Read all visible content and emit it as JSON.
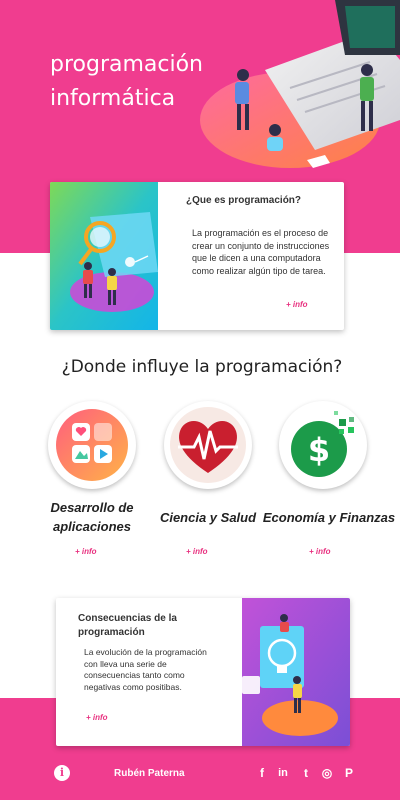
{
  "hero": {
    "title_line1": "programación",
    "title_line2": "informática"
  },
  "intro_card": {
    "title": "¿Que es programación?",
    "text": "La programación es el proceso de crear un conjunto de instrucciones que le dicen a una computadora como realizar algún tipo de tarea.",
    "more_label": "+ info"
  },
  "influence": {
    "title": "¿Donde influye la programación?",
    "areas": [
      {
        "label_line1": "Desarrollo de",
        "label_line2": "aplicaciones",
        "more_label": "+ info",
        "icon": "apps-icon"
      },
      {
        "label_line1": "Ciencia y Salud",
        "label_line2": "",
        "more_label": "+ info",
        "icon": "heart-pulse-icon"
      },
      {
        "label_line1": "Economía y Finanzas",
        "label_line2": "",
        "more_label": "+ info",
        "icon": "dollar-icon"
      }
    ]
  },
  "consequences_card": {
    "title": "Consecuencias de la programación",
    "text": "La evolución de la programación con lleva una serie de consecuencias tanto como negativas como positibas.",
    "more_label": "+ info"
  },
  "footer": {
    "info_icon": "info-icon",
    "info_glyph": "i",
    "author": "Rubén Paterna",
    "social": [
      {
        "name": "facebook-icon",
        "glyph": "f"
      },
      {
        "name": "linkedin-icon",
        "glyph": "in"
      },
      {
        "name": "twitter-icon",
        "glyph": "t"
      },
      {
        "name": "instagram-icon",
        "glyph": "◎"
      },
      {
        "name": "pinterest-icon",
        "glyph": "P"
      }
    ]
  },
  "colors": {
    "brand_pink": "#f03d8f",
    "link_pink": "#e8307f",
    "text_dark": "#222222"
  }
}
